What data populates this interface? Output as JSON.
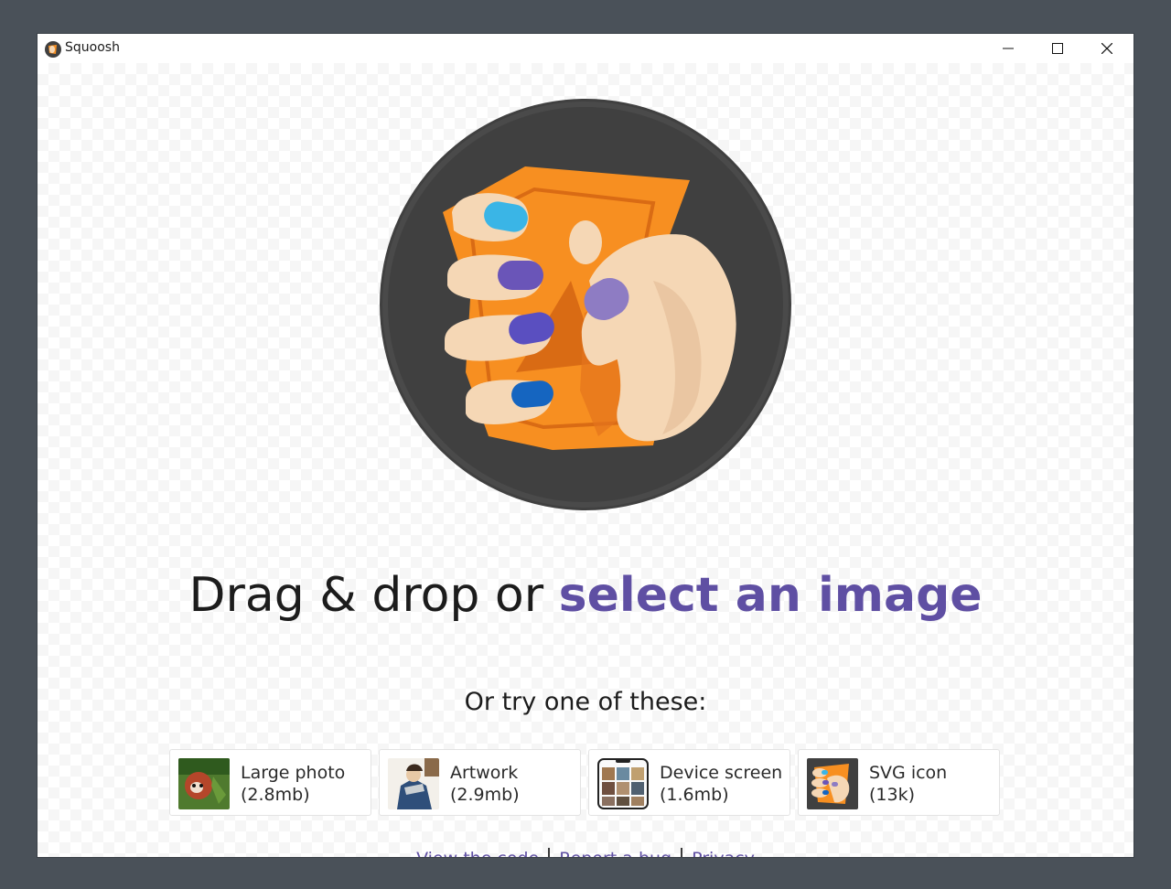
{
  "window": {
    "title": "Squoosh",
    "app_icon": "squoosh-logo-icon",
    "controls": [
      "minimize-icon",
      "maximize-icon",
      "close-icon"
    ]
  },
  "intro": {
    "headline_prefix": "Drag & drop or ",
    "headline_link": "select an image",
    "subheading": "Or try one of these:"
  },
  "demos": [
    {
      "name": "Large photo",
      "size": "(2.8mb)",
      "thumb": "red-panda-photo"
    },
    {
      "name": "Artwork",
      "size": "(2.9mb)",
      "thumb": "artwork-illustration"
    },
    {
      "name": "Device screen",
      "size": "(1.6mb)",
      "thumb": "phone-screenshot"
    },
    {
      "name": "SVG icon",
      "size": "(13k)",
      "thumb": "squoosh-logo"
    }
  ],
  "footer": {
    "links": [
      "View the code",
      "Report a bug",
      "Privacy"
    ]
  },
  "colors": {
    "accent": "#5f4fa3",
    "logo_circle": "#404040",
    "logo_orange": "#f78f21"
  }
}
